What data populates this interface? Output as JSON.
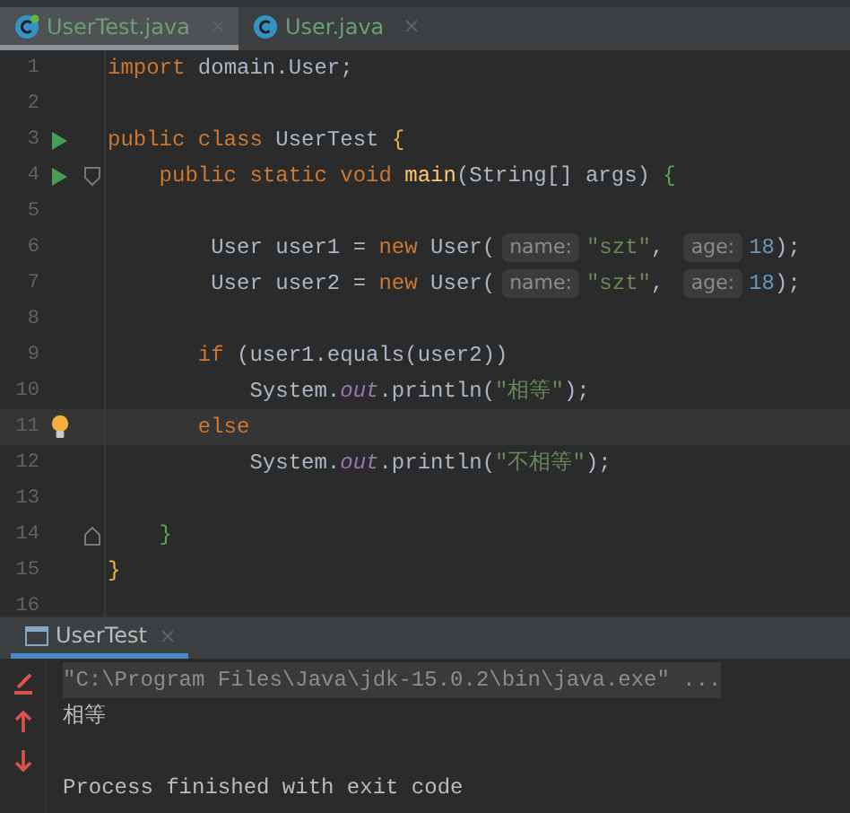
{
  "editor_tabs": [
    {
      "label": "UserTest.java",
      "selected": true,
      "runnable": true
    },
    {
      "label": "User.java",
      "selected": false,
      "runnable": false
    }
  ],
  "code_lines": [
    {
      "number": "1",
      "tokens": [
        {
          "kind": "keyword",
          "text": "import"
        },
        {
          "kind": "plain",
          "text": " domain.User;"
        }
      ]
    },
    {
      "number": "2"
    },
    {
      "number": "3",
      "gutter_icons": [
        {
          "kind": "run"
        }
      ],
      "tokens": [
        {
          "kind": "keyword",
          "text": "public class"
        },
        {
          "kind": "plain",
          "text": " UserTest "
        },
        {
          "kind": "brace",
          "text": "{"
        }
      ]
    },
    {
      "number": "4",
      "gutter_icons": [
        {
          "kind": "run"
        },
        {
          "kind": "fold_start"
        }
      ],
      "tokens": [
        {
          "kind": "keyword",
          "text": "    public static void "
        },
        {
          "kind": "method",
          "text": "main"
        },
        {
          "kind": "plain",
          "text": "(String[] args) "
        },
        {
          "kind": "inner_brace",
          "text": "{"
        }
      ]
    },
    {
      "number": "5"
    },
    {
      "number": "6",
      "tokens": [
        {
          "kind": "plain",
          "text": "        User user1 = "
        },
        {
          "kind": "keyword",
          "text": "new"
        },
        {
          "kind": "plain",
          "text": " User("
        },
        {
          "kind": "hint",
          "text": "name:"
        },
        {
          "kind": "string",
          "text": "\"szt\""
        },
        {
          "kind": "plain",
          "text": ", "
        },
        {
          "kind": "hint",
          "text": "age:"
        },
        {
          "kind": "number",
          "text": "18"
        },
        {
          "kind": "plain",
          "text": ");"
        }
      ]
    },
    {
      "number": "7",
      "tokens": [
        {
          "kind": "plain",
          "text": "        User user2 = "
        },
        {
          "kind": "keyword",
          "text": "new"
        },
        {
          "kind": "plain",
          "text": " User("
        },
        {
          "kind": "hint",
          "text": "name:"
        },
        {
          "kind": "string",
          "text": "\"szt\""
        },
        {
          "kind": "plain",
          "text": ", "
        },
        {
          "kind": "hint",
          "text": "age:"
        },
        {
          "kind": "number",
          "text": "18"
        },
        {
          "kind": "plain",
          "text": ");"
        }
      ]
    },
    {
      "number": "8"
    },
    {
      "number": "9",
      "tokens": [
        {
          "kind": "keyword",
          "text": "       if"
        },
        {
          "kind": "plain",
          "text": " (user1.equals(user2))"
        }
      ]
    },
    {
      "number": "10",
      "tokens": [
        {
          "kind": "plain",
          "text": "           System."
        },
        {
          "kind": "field",
          "text": "out"
        },
        {
          "kind": "plain",
          "text": ".println("
        },
        {
          "kind": "string",
          "text": "\"相等\""
        },
        {
          "kind": "plain",
          "text": ");"
        }
      ]
    },
    {
      "number": "11",
      "current": true,
      "gutter_icons": [
        {
          "kind": "bulb"
        }
      ],
      "tokens": [
        {
          "kind": "keyword",
          "text": "       else"
        }
      ]
    },
    {
      "number": "12",
      "tokens": [
        {
          "kind": "plain",
          "text": "           System."
        },
        {
          "kind": "field",
          "text": "out"
        },
        {
          "kind": "plain",
          "text": ".println("
        },
        {
          "kind": "string",
          "text": "\"不相等\""
        },
        {
          "kind": "plain",
          "text": ");"
        }
      ]
    },
    {
      "number": "13"
    },
    {
      "number": "14",
      "gutter_icons": [
        {
          "kind": "fold_end"
        }
      ],
      "tokens": [
        {
          "kind": "inner_brace",
          "text": "    }"
        }
      ]
    },
    {
      "number": "15",
      "tokens": [
        {
          "kind": "brace",
          "text": "}"
        }
      ]
    },
    {
      "number": "16"
    }
  ],
  "run_panel": {
    "tab": {
      "label": "UserTest",
      "selected": true
    },
    "console_lines": [
      {
        "kind": "command",
        "text": "\"C:\\Program Files\\Java\\jdk-15.0.2\\bin\\java.exe\" ..."
      },
      {
        "kind": "output",
        "text": "相等"
      },
      {
        "kind": "status",
        "text": "Process finished with exit code"
      }
    ]
  }
}
